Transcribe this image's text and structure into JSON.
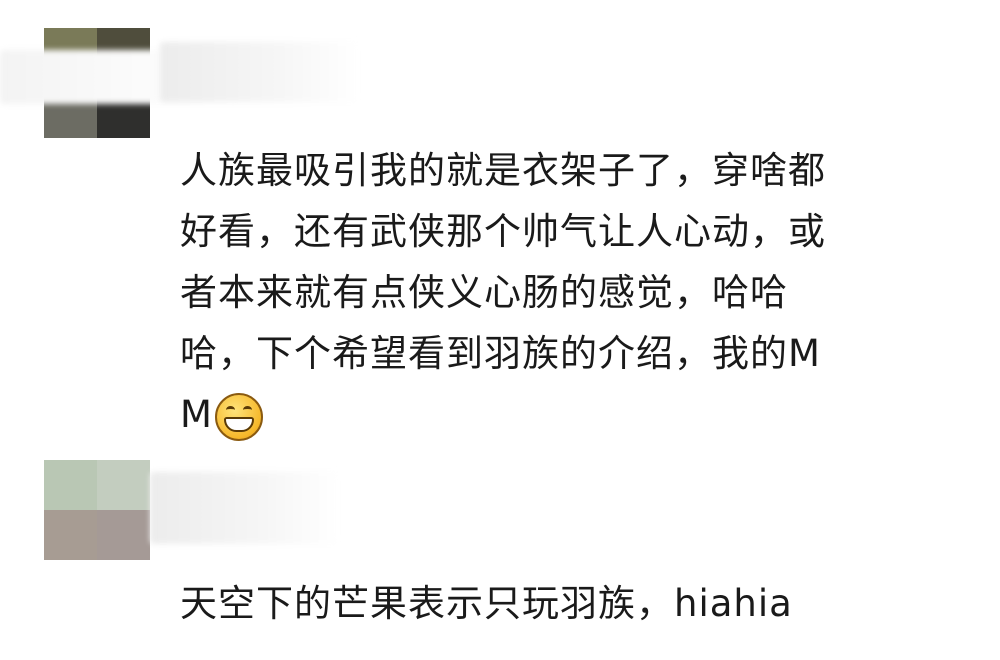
{
  "comments": [
    {
      "text": "人族最吸引我的就是衣架子了，穿啥都\n好看，还有武侠那个帅气让人心动，或\n者本来就有点侠义心肠的感觉，哈哈\n哈，下个希望看到羽族的介绍，我的M\nM",
      "emoji": "grinning-face-icon",
      "avatar_colors": [
        "#7a7a58",
        "#4f4d3c",
        "#6c6c63",
        "#2f2f2d"
      ]
    },
    {
      "text": "天空下的芒果表示只玩羽族，hiahia",
      "avatar_colors": [
        "#b9c7b4",
        "#c3cdbf",
        "#a79c93",
        "#a59a96"
      ]
    }
  ]
}
